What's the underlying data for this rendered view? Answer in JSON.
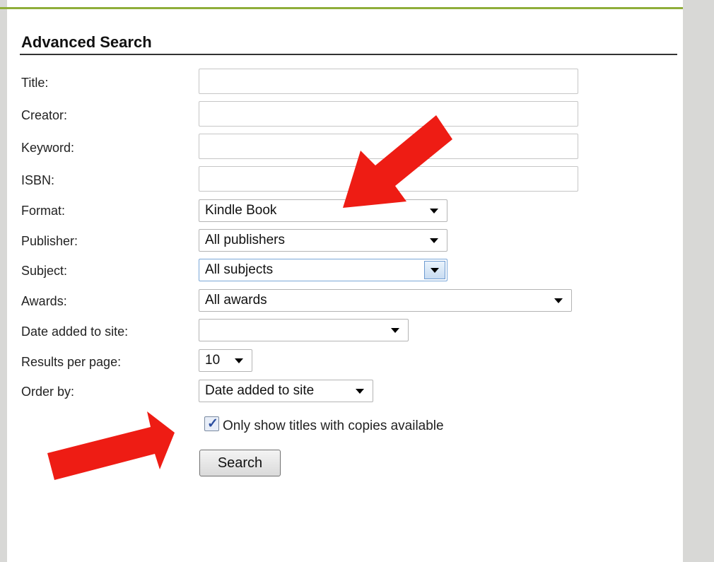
{
  "form": {
    "title": "Advanced Search",
    "labels": {
      "title": "Title:",
      "creator": "Creator:",
      "keyword": "Keyword:",
      "isbn": "ISBN:",
      "format": "Format:",
      "publisher": "Publisher:",
      "subject": "Subject:",
      "awards": "Awards:",
      "date_added": "Date added to site:",
      "results_per_page": "Results per page:",
      "order_by": "Order by:"
    },
    "values": {
      "title": "",
      "creator": "",
      "keyword": "",
      "isbn": "",
      "format": "Kindle Book",
      "publisher": "All publishers",
      "subject": "All subjects",
      "awards": "All awards",
      "date_added": "",
      "results_per_page": "10",
      "order_by": "Date added to site"
    },
    "copies_available": {
      "label": "Only show titles with copies available",
      "checked": true
    },
    "search_button": "Search"
  },
  "colors": {
    "annotation_arrow": "#ee1c14",
    "top_bar": "#8fae3a"
  }
}
